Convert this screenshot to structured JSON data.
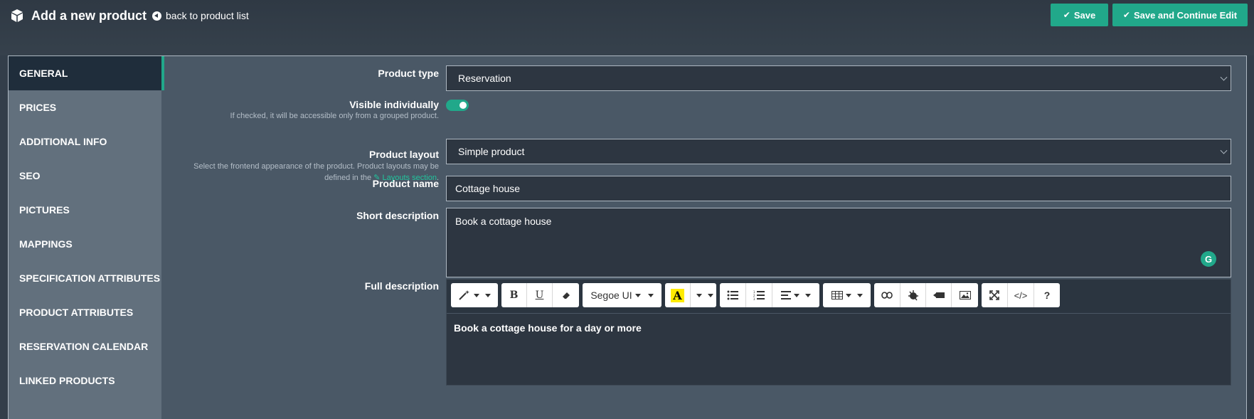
{
  "header": {
    "title": "Add a new product",
    "back_link": "back to product list",
    "save_label": "Save",
    "save_continue_label": "Save and Continue Edit"
  },
  "colors": {
    "accent": "#21a88a",
    "background": "#333e4a",
    "sidebar": "#62707d",
    "sidebar_active": "#1f2d3b"
  },
  "sidebar": {
    "items": [
      {
        "label": "GENERAL",
        "active": true
      },
      {
        "label": "PRICES"
      },
      {
        "label": "ADDITIONAL INFO"
      },
      {
        "label": "SEO"
      },
      {
        "label": "PICTURES"
      },
      {
        "label": "MAPPINGS"
      },
      {
        "label": "SPECIFICATION ATTRIBUTES"
      },
      {
        "label": "PRODUCT ATTRIBUTES"
      },
      {
        "label": "RESERVATION CALENDAR"
      },
      {
        "label": "LINKED PRODUCTS"
      }
    ]
  },
  "form": {
    "product_type": {
      "label": "Product type",
      "value": "Reservation"
    },
    "visible_individually": {
      "label": "Visible individually",
      "hint": "If checked, it will be accessible only from a grouped product.",
      "checked": true
    },
    "product_layout": {
      "label": "Product layout",
      "hint_prefix": "Select the frontend appearance of the product. Product layouts may be defined in the",
      "hint_link": "Layouts section",
      "hint_suffix": ".",
      "value": "Simple product"
    },
    "product_name": {
      "label": "Product name",
      "value": "Cottage house"
    },
    "short_description": {
      "label": "Short description",
      "value": "Book a cottage house"
    },
    "full_description": {
      "label": "Full description",
      "font_name": "Segoe UI",
      "content": "Book a cottage house for a day or more"
    }
  }
}
